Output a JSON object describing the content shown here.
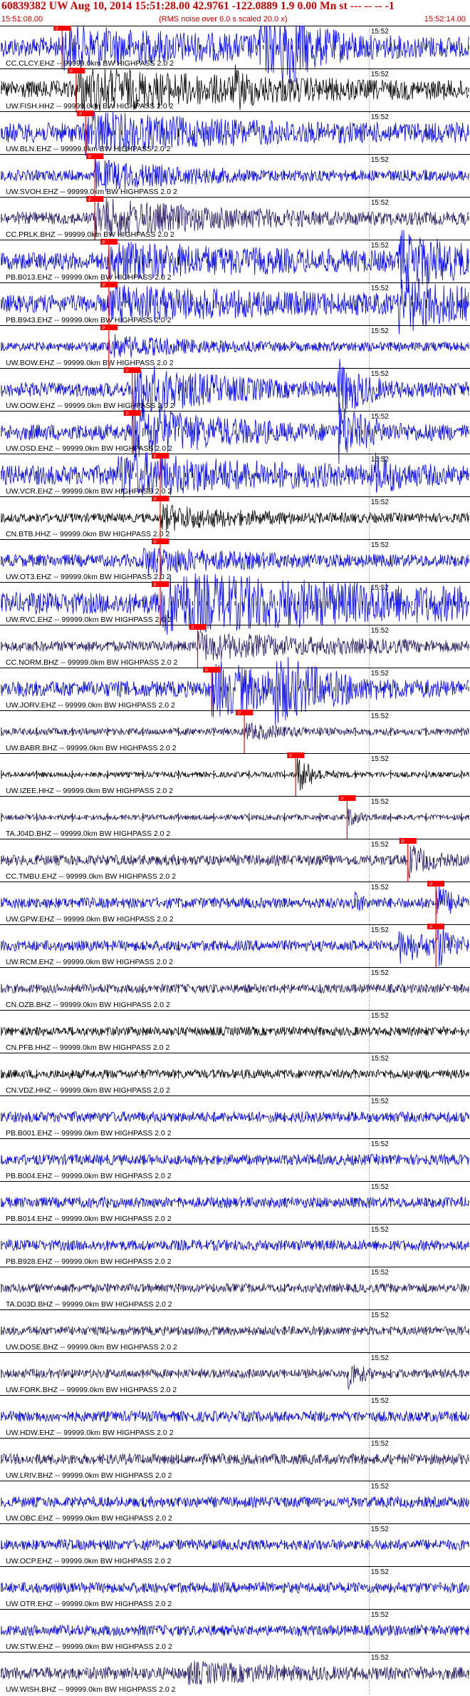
{
  "header": {
    "title": "60839382 UW Aug 10, 2014 15:51:28.00   42.9761 -122.0889  1.9 0.00 Mn st --- -- --  -1",
    "subtitle": "(RMS noise over 6.0 s scaled 20.0 x)",
    "time_start": "15:51:08.00",
    "time_end": "15:52:14.00"
  },
  "colors": {
    "blue": "#0000ff",
    "black": "#000000",
    "purple": "#2a1a66",
    "pick": "#ff0000"
  },
  "chart_data": {
    "type": "line",
    "minute_label": "15:52",
    "pick_label": "P",
    "channels": [
      {
        "label": "CC.CLCY.EHZ -- 99999.0km BW  HIGHPASS  2.0  2",
        "color": "blue",
        "pick": 0.13,
        "amp": 0.55,
        "bursts": [
          [
            0.13,
            0.35,
            0.8
          ],
          [
            0.55,
            0.15,
            1.1
          ],
          [
            0.6,
            0.05,
            1.6
          ]
        ]
      },
      {
        "label": "UW.FISH.HHZ -- 99999.0km BW  HIGHPASS  2.0  2",
        "color": "black",
        "pick": 0.16,
        "amp": 0.5,
        "bursts": [
          [
            0.16,
            0.4,
            0.9
          ],
          [
            0.5,
            0.03,
            0.6
          ]
        ]
      },
      {
        "label": "UW.BLN.EHZ -- 99999.0km BW  HIGHPASS  2.0  2",
        "color": "blue",
        "pick": 0.18,
        "amp": 0.55,
        "bursts": [
          [
            0.18,
            0.3,
            0.8
          ]
        ]
      },
      {
        "label": "UW.SVOH.EHZ -- 99999.0km BW  HIGHPASS  2.0  2",
        "color": "blue",
        "pick": 0.2,
        "amp": 0.3,
        "bursts": [
          [
            0.2,
            0.2,
            0.7
          ]
        ]
      },
      {
        "label": "CC.PRLK.BHZ -- 99999.0km BW  HIGHPASS  2.0  2",
        "color": "purple",
        "pick": 0.2,
        "amp": 0.35,
        "bursts": [
          [
            0.2,
            0.3,
            0.9
          ]
        ]
      },
      {
        "label": "PB.B013.EHZ -- 99999.0km BW  HIGHPASS  2.0  2",
        "color": "blue",
        "pick": 0.23,
        "amp": 0.5,
        "bursts": [
          [
            0.23,
            0.4,
            0.7
          ],
          [
            0.85,
            0.15,
            1.4
          ]
        ]
      },
      {
        "label": "PB.B943.EHZ -- 99999.0km BW  HIGHPASS  2.0  2",
        "color": "blue",
        "pick": 0.23,
        "amp": 0.5,
        "bursts": [
          [
            0.23,
            0.4,
            0.7
          ],
          [
            0.85,
            0.15,
            1.3
          ]
        ]
      },
      {
        "label": "UW.BOW.EHZ -- 99999.0km BW  HIGHPASS  2.0  2",
        "color": "blue",
        "pick": 0.23,
        "amp": 0.25,
        "bursts": [
          [
            0.23,
            0.2,
            0.5
          ]
        ]
      },
      {
        "label": "UW.OOW.EHZ -- 99999.0km BW  HIGHPASS  2.0  2",
        "color": "blue",
        "pick": 0.28,
        "amp": 0.4,
        "bursts": [
          [
            0.28,
            0.2,
            1.3
          ],
          [
            0.72,
            0.06,
            1.4
          ]
        ]
      },
      {
        "label": "UW.OSD.EHZ -- 99999.0km BW  HIGHPASS  2.0  2",
        "color": "blue",
        "pick": 0.28,
        "amp": 0.45,
        "bursts": [
          [
            0.28,
            0.2,
            1.3
          ],
          [
            0.72,
            0.06,
            1.4
          ]
        ]
      },
      {
        "label": "UW.VCR.EHZ -- 99999.0km BW  HIGHPASS  2.0  2",
        "color": "blue",
        "pick": 0.34,
        "amp": 0.55,
        "bursts": [
          [
            0.25,
            0.3,
            0.9
          ],
          [
            0.8,
            0.05,
            0.8
          ]
        ]
      },
      {
        "label": "CN.BTB.HHZ -- 99999.0km BW  HIGHPASS  2.0  2",
        "color": "black",
        "pick": 0.34,
        "amp": 0.25,
        "bursts": [
          [
            0.34,
            0.2,
            0.6
          ]
        ]
      },
      {
        "label": "UW.OT3.EHZ -- 99999.0km BW  HIGHPASS  2.0  2",
        "color": "blue",
        "pick": 0.34,
        "amp": 0.35,
        "bursts": [
          [
            0.3,
            0.2,
            0.6
          ]
        ]
      },
      {
        "label": "UW.RVC.EHZ -- 99999.0km BW  HIGHPASS  2.0  2",
        "color": "blue",
        "pick": 0.34,
        "amp": 0.6,
        "bursts": [
          [
            0.34,
            0.66,
            1.3
          ]
        ]
      },
      {
        "label": "CC.NORM.BHZ -- 99999.0km BW  HIGHPASS  2.0  2",
        "color": "purple",
        "pick": 0.42,
        "amp": 0.3,
        "bursts": [
          [
            0.42,
            0.3,
            0.6
          ]
        ]
      },
      {
        "label": "UW.JORV.EHZ -- 99999.0km BW  HIGHPASS  2.0  2",
        "color": "blue",
        "pick": 0.45,
        "amp": 0.45,
        "bursts": [
          [
            0.45,
            0.2,
            1.3
          ],
          [
            0.58,
            0.12,
            1.2
          ]
        ]
      },
      {
        "label": "UW.BABR.BHZ -- 99999.0km BW  HIGHPASS  2.0  2",
        "color": "purple",
        "pick": 0.52,
        "amp": 0.2,
        "bursts": [
          [
            0.52,
            0.1,
            0.4
          ]
        ]
      },
      {
        "label": "UW.IZEE.HHZ -- 99999.0km BW  HIGHPASS  2.0  2",
        "color": "black",
        "pick": 0.63,
        "amp": 0.15,
        "bursts": [
          [
            0.63,
            0.04,
            1.1
          ]
        ]
      },
      {
        "label": "TA.J04D.BHZ -- 99999.0km BW  HIGHPASS  2.0  2",
        "color": "purple",
        "pick": 0.74,
        "amp": 0.15,
        "bursts": [
          [
            0.74,
            0.03,
            0.5
          ]
        ]
      },
      {
        "label": "CC.TMBU.EHZ -- 99999.0km BW  HIGHPASS  2.0  2",
        "color": "purple",
        "pick": 0.87,
        "amp": 0.3,
        "bursts": [
          [
            0.87,
            0.05,
            0.8
          ]
        ]
      },
      {
        "label": "UW.GPW.EHZ -- 99999.0km BW  HIGHPASS  2.0  2",
        "color": "blue",
        "pick": 0.93,
        "amp": 0.3,
        "bursts": [
          [
            0.75,
            0.02,
            0.6
          ],
          [
            0.93,
            0.04,
            0.9
          ]
        ]
      },
      {
        "label": "UW.RCM.EHZ -- 99999.0km BW  HIGHPASS  2.0  2",
        "color": "blue",
        "pick": 0.93,
        "amp": 0.3,
        "bursts": [
          [
            0.85,
            0.08,
            0.8
          ],
          [
            0.93,
            0.04,
            1.0
          ]
        ]
      },
      {
        "label": "CN.OZB.BHZ -- 99999.0km BW  HIGHPASS  2.0  2",
        "color": "purple",
        "pick": null,
        "amp": 0.25,
        "bursts": []
      },
      {
        "label": "CN.PFB.HHZ -- 99999.0km BW  HIGHPASS  2.0  2",
        "color": "black",
        "pick": null,
        "amp": 0.25,
        "bursts": []
      },
      {
        "label": "CN.VDZ.HHZ -- 99999.0km BW  HIGHPASS  2.0  2",
        "color": "black",
        "pick": null,
        "amp": 0.25,
        "bursts": []
      },
      {
        "label": "PB.B001.EHZ -- 99999.0km BW  HIGHPASS  2.0  2",
        "color": "blue",
        "pick": null,
        "amp": 0.3,
        "bursts": []
      },
      {
        "label": "PB.B004.EHZ -- 99999.0km BW  HIGHPASS  2.0  2",
        "color": "blue",
        "pick": null,
        "amp": 0.3,
        "bursts": []
      },
      {
        "label": "PB.B014.EHZ -- 99999.0km BW  HIGHPASS  2.0  2",
        "color": "blue",
        "pick": null,
        "amp": 0.3,
        "bursts": []
      },
      {
        "label": "PB.B928.EHZ -- 99999.0km BW  HIGHPASS  2.0  2",
        "color": "blue",
        "pick": null,
        "amp": 0.3,
        "bursts": []
      },
      {
        "label": "TA.D03D.BHZ -- 99999.0km BW  HIGHPASS  2.0  2",
        "color": "purple",
        "pick": null,
        "amp": 0.25,
        "bursts": []
      },
      {
        "label": "UW.DOSE.BHZ -- 99999.0km BW  HIGHPASS  2.0  2",
        "color": "purple",
        "pick": null,
        "amp": 0.25,
        "bursts": []
      },
      {
        "label": "UW.FORK.BHZ -- 99999.0km BW  HIGHPASS  2.0  2",
        "color": "purple",
        "pick": null,
        "amp": 0.25,
        "bursts": [
          [
            0.74,
            0.03,
            0.8
          ]
        ]
      },
      {
        "label": "UW.HDW.EHZ -- 99999.0km BW  HIGHPASS  2.0  2",
        "color": "blue",
        "pick": null,
        "amp": 0.3,
        "bursts": []
      },
      {
        "label": "UW.LRIV.BHZ -- 99999.0km BW  HIGHPASS  2.0  2",
        "color": "purple",
        "pick": null,
        "amp": 0.3,
        "bursts": []
      },
      {
        "label": "UW.OBC.EHZ -- 99999.0km BW  HIGHPASS  2.0  2",
        "color": "blue",
        "pick": null,
        "amp": 0.3,
        "bursts": []
      },
      {
        "label": "UW.OCP.EHZ -- 99999.0km BW  HIGHPASS  2.0  2",
        "color": "blue",
        "pick": null,
        "amp": 0.3,
        "bursts": []
      },
      {
        "label": "UW.OTR.EHZ -- 99999.0km BW  HIGHPASS  2.0  2",
        "color": "blue",
        "pick": null,
        "amp": 0.3,
        "bursts": []
      },
      {
        "label": "UW.STW.EHZ -- 99999.0km BW  HIGHPASS  2.0  2",
        "color": "blue",
        "pick": null,
        "amp": 0.3,
        "bursts": []
      },
      {
        "label": "UW.WISH.BHZ -- 99999.0km BW  HIGHPASS  2.0  2",
        "color": "purple",
        "pick": null,
        "amp": 0.35,
        "bursts": [
          [
            0.4,
            0.2,
            0.4
          ]
        ]
      }
    ]
  }
}
